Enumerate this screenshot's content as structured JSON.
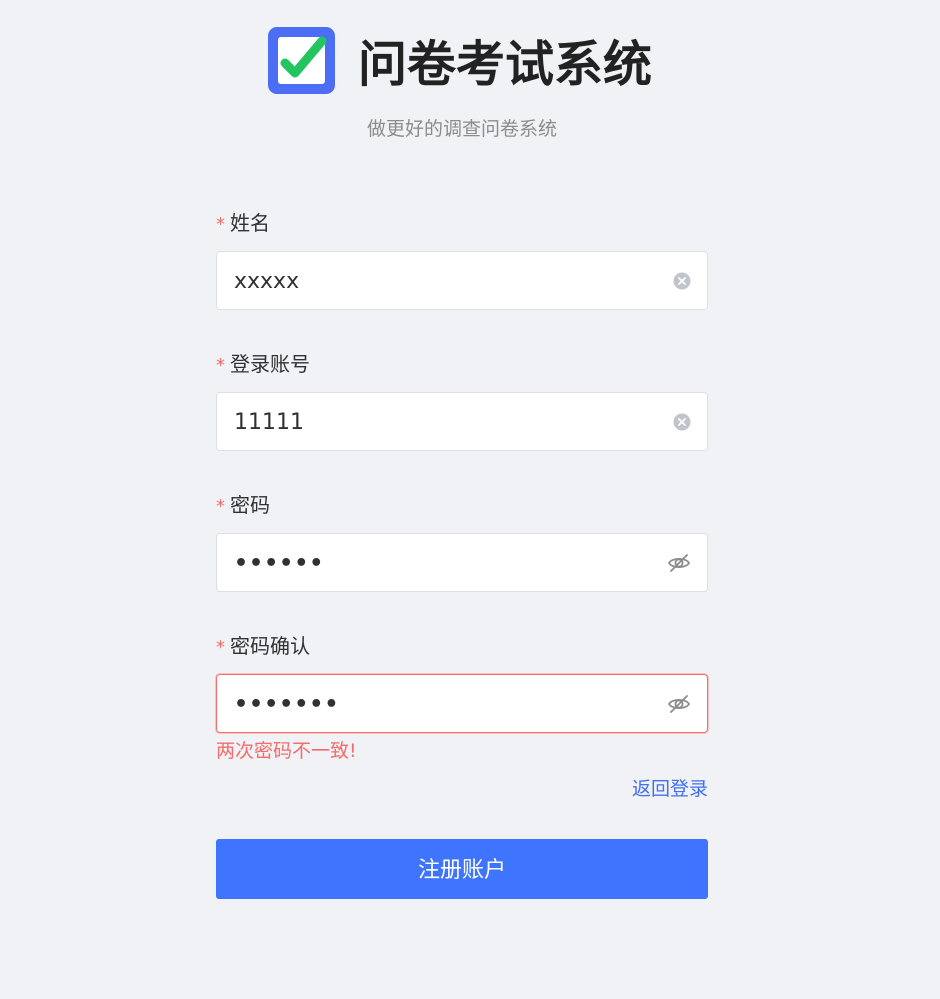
{
  "header": {
    "title": "问卷考试系统",
    "subtitle": "做更好的调查问卷系统",
    "logo_icon": "checkbox-check-icon"
  },
  "form": {
    "fields": [
      {
        "label": "姓名",
        "value": "xxxxx",
        "required_mark": "*",
        "action_icon": "clear-icon"
      },
      {
        "label": "登录账号",
        "value": "11111",
        "required_mark": "*",
        "action_icon": "clear-icon"
      },
      {
        "label": "密码",
        "value": "••••••",
        "required_mark": "*",
        "action_icon": "eye-off-icon"
      },
      {
        "label": "密码确认",
        "value": "•••••••",
        "required_mark": "*",
        "action_icon": "eye-off-icon"
      }
    ],
    "error_message": "两次密码不一致!",
    "back_link": "返回登录",
    "submit_label": "注册账户"
  },
  "colors": {
    "background": "#f0f2f5",
    "primary": "#3f74ff",
    "link": "#3f6ff6",
    "error": "#f56c6c",
    "logo_blue": "#4c6ef5",
    "logo_check": "#22c55e"
  }
}
